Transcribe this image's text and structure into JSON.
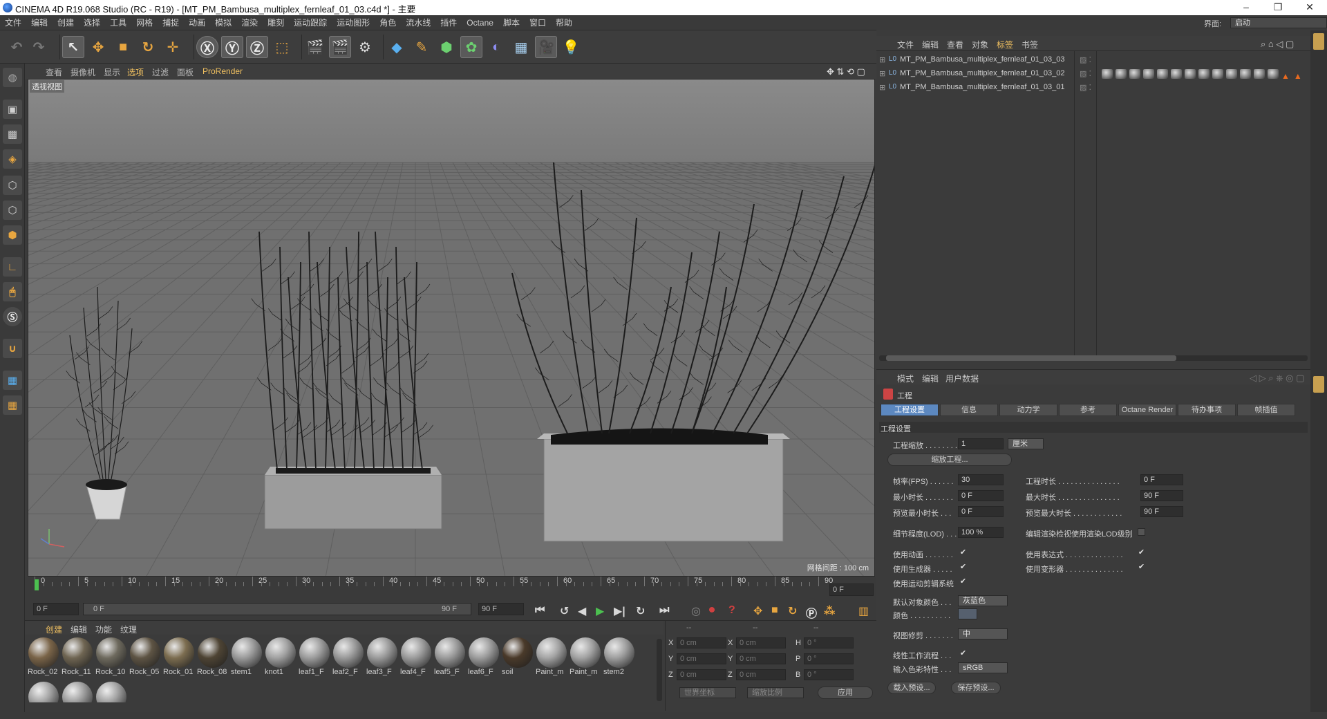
{
  "window": {
    "title": "CINEMA 4D R19.068 Studio (RC - R19) - [MT_PM_Bambusa_multiplex_fernleaf_01_03.c4d *] - 主要"
  },
  "menu": [
    "文件",
    "编辑",
    "创建",
    "选择",
    "工具",
    "网格",
    "捕捉",
    "动画",
    "模拟",
    "渲染",
    "雕刻",
    "运动跟踪",
    "运动图形",
    "角色",
    "流水线",
    "插件",
    "Octane",
    "脚本",
    "窗口",
    "帮助"
  ],
  "layout": {
    "label": "界面:",
    "value": "启动"
  },
  "viewport": {
    "menu": [
      "查看",
      "摄像机",
      "显示",
      "选项",
      "过滤",
      "面板",
      "ProRender"
    ],
    "name": "透视视图",
    "grid_info": "网格间距 : 100 cm"
  },
  "timeline": {
    "ticks": [
      "0",
      "5",
      "10",
      "15",
      "20",
      "25",
      "30",
      "35",
      "40",
      "45",
      "50",
      "55",
      "60",
      "65",
      "70",
      "75",
      "80",
      "85",
      "90"
    ],
    "current_frame": "0 F",
    "start": "0 F",
    "range_start": "0 F",
    "range_end": "90 F",
    "end": "90 F"
  },
  "materials": {
    "menu": [
      "创建",
      "编辑",
      "功能",
      "纹理"
    ],
    "items": [
      {
        "label": "Rock_02",
        "color": "#7a6448"
      },
      {
        "label": "Rock_11",
        "color": "#6f6552"
      },
      {
        "label": "Rock_10",
        "color": "#6e6a5e"
      },
      {
        "label": "Rock_05",
        "color": "#5e5444"
      },
      {
        "label": "Rock_01",
        "color": "#7c6d50"
      },
      {
        "label": "Rock_08",
        "color": "#4e4434"
      },
      {
        "label": "stem1",
        "color": "#9a9a9a"
      },
      {
        "label": "knot1",
        "color": "#a0a0a0"
      },
      {
        "label": "leaf1_F",
        "color": "#9c9c9c"
      },
      {
        "label": "leaf2_F",
        "color": "#999999"
      },
      {
        "label": "leaf3_F",
        "color": "#9a9a9a"
      },
      {
        "label": "leaf4_F",
        "color": "#9b9b9b"
      },
      {
        "label": "leaf5_F",
        "color": "#9a9a9a"
      },
      {
        "label": "leaf6_F",
        "color": "#9c9c9c"
      },
      {
        "label": "soil",
        "color": "#4a3a2a"
      },
      {
        "label": "Paint_m",
        "color": "#a4a4a4"
      },
      {
        "label": "Paint_m",
        "color": "#a2a2a2"
      },
      {
        "label": "stem2",
        "color": "#9e9e9e"
      }
    ],
    "extra_row_colors": [
      "#a2a2a2",
      "#9c9c9c",
      "#a0a0a0"
    ]
  },
  "coords": {
    "headers": [
      "--",
      "--",
      "--"
    ],
    "rows": [
      {
        "a": "X",
        "av": "0 cm",
        "b": "X",
        "bv": "0 cm",
        "c": "H",
        "cv": "0 °"
      },
      {
        "a": "Y",
        "av": "0 cm",
        "b": "Y",
        "bv": "0 cm",
        "c": "P",
        "cv": "0 °"
      },
      {
        "a": "Z",
        "av": "0 cm",
        "b": "Z",
        "bv": "0 cm",
        "c": "B",
        "cv": "0 °"
      }
    ],
    "world": "世界坐标",
    "scale": "缩放比例",
    "apply": "应用"
  },
  "objects": {
    "menu": [
      "文件",
      "编辑",
      "查看",
      "对象",
      "标签",
      "书签"
    ],
    "rows": [
      {
        "name": "MT_PM_Bambusa_multiplex_fernleaf_01_03_03"
      },
      {
        "name": "MT_PM_Bambusa_multiplex_fernleaf_01_03_02"
      },
      {
        "name": "MT_PM_Bambusa_multiplex_fernleaf_01_03_01"
      }
    ]
  },
  "attributes": {
    "menu": [
      "模式",
      "编辑",
      "用户数据"
    ],
    "object": "工程",
    "tabs": [
      "工程设置",
      "信息",
      "动力学",
      "参考",
      "Octane Render",
      "待办事项",
      "帧插值"
    ],
    "section": "工程设置",
    "scale_label": "工程缩放 . . . . . . . .",
    "scale_value": "1",
    "scale_unit": "厘米",
    "scale_button": "缩放工程...",
    "fps_label": "帧率(FPS) . . . . . .",
    "fps_value": "30",
    "duration_label": "工程时长 . . . . . . . . . . . . . . .",
    "duration_value": "0 F",
    "min_label": "最小时长 . . . . . . .",
    "min_value": "0 F",
    "max_label": "最大时长 . . . . . . . . . . . . . . .",
    "max_value": "90 F",
    "pmin_label": "预览最小时长 . . .",
    "pmin_value": "0 F",
    "pmax_label": "预览最大时长 . . . . . . . . . . . .",
    "pmax_value": "90 F",
    "lod_label": "细节程度(LOD) . . .",
    "lod_value": "100 %",
    "lod_render_label": "编辑渲染检视使用渲染LOD级别",
    "use_anim": "使用动画 . . . . . . .",
    "use_expr": "使用表达式 . . . . . . . . . . . . . .",
    "use_gen": "使用生成器 . . . . .",
    "use_deform": "使用变形器 . . . . . . . . . . . . . .",
    "use_motion": "使用运动剪辑系统",
    "def_color_label": "默认对象颜色 . . .",
    "def_color_value": "灰蓝色",
    "color_label": "颜色 . . . . . . . . . .",
    "clip_label": "视图修剪 . . . . . . .",
    "clip_value": "中",
    "linear_label": "线性工作流程 . . .",
    "input_label": "输入色彩特性 . . .",
    "input_value": "sRGB",
    "load_preset": "载入预设...",
    "save_preset": "保存预设..."
  },
  "colors": {
    "accent": "#5c88c0",
    "viewport_bg": "#777777",
    "panel": "#3b3b3b"
  }
}
